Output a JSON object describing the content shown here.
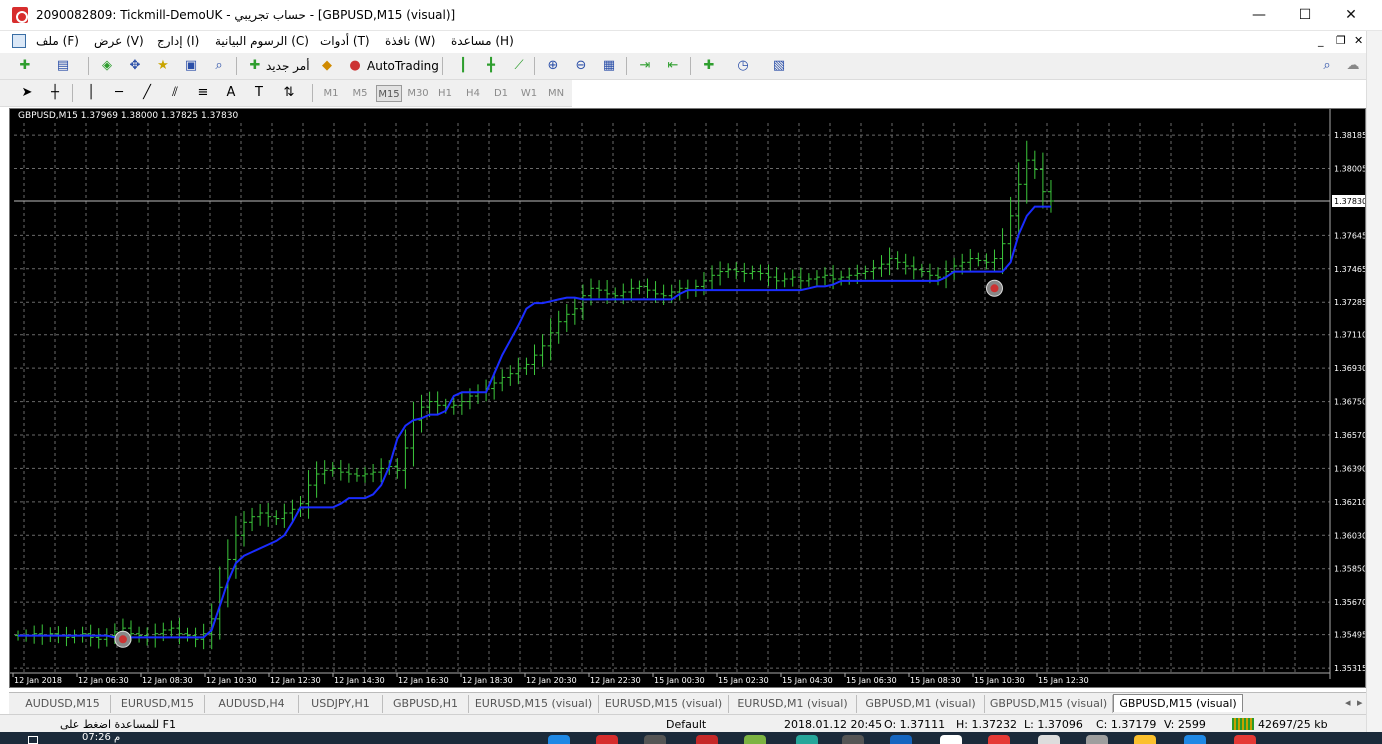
{
  "window": {
    "title": "2090082809: Tickmill-DemoUK - حساب تجريبي - [GBPUSD,M15 (visual)]",
    "min_glyph": "—",
    "max_glyph": "☐",
    "close_glyph": "✕"
  },
  "menu": {
    "items": [
      "ملف (F)",
      "عرض (V)",
      "إدارج (I)",
      "الرسوم البيانية (C)",
      "أدوات (T)",
      "نافذة (W)",
      "مساعدة (H)"
    ],
    "mdi_controls": [
      "_",
      "❐",
      "✕"
    ]
  },
  "toolbar": {
    "new_order_label": "أمر جديد",
    "autotrading_label": "AutoTrading"
  },
  "timeframes": {
    "items": [
      "M1",
      "M5",
      "M15",
      "M30",
      "H1",
      "H4",
      "D1",
      "W1",
      "MN"
    ],
    "active": "M15"
  },
  "chart_header": "GBPUSD,M15  1.37969 1.38000 1.37825 1.37830",
  "chart_data": {
    "type": "candlestick",
    "symbol": "GBPUSD",
    "timeframe": "M15",
    "ohlc_readout": {
      "open": 1.37969,
      "high": 1.38,
      "low": 1.37825,
      "close": 1.3783
    },
    "current_price": "1.37830",
    "ylim": [
      1.3531,
      1.3825
    ],
    "y_tick_labels": [
      "1.38185",
      "1.38005",
      "1.37830",
      "1.37645",
      "1.37465",
      "1.37285",
      "1.37110",
      "1.36930",
      "1.36750",
      "1.36570",
      "1.36390",
      "1.36210",
      "1.36030",
      "1.35850",
      "1.35670",
      "1.35495",
      "1.35315"
    ],
    "y_tick_values": [
      1.38185,
      1.38005,
      1.3783,
      1.37645,
      1.37465,
      1.37285,
      1.3711,
      1.3693,
      1.3675,
      1.3657,
      1.3639,
      1.3621,
      1.3603,
      1.3585,
      1.3567,
      1.35495,
      1.35315
    ],
    "x_tick_labels": [
      "12 Jan 2018",
      "12 Jan 06:30",
      "12 Jan 08:30",
      "12 Jan 10:30",
      "12 Jan 12:30",
      "12 Jan 14:30",
      "12 Jan 16:30",
      "12 Jan 18:30",
      "12 Jan 20:30",
      "12 Jan 22:30",
      "15 Jan 00:30",
      "15 Jan 02:30",
      "15 Jan 04:30",
      "15 Jan 06:30",
      "15 Jan 08:30",
      "15 Jan 10:30",
      "15 Jan 12:30"
    ],
    "price_series": [
      1.3549,
      1.3549,
      1.355,
      1.3549,
      1.355,
      1.3549,
      1.3548,
      1.3549,
      1.355,
      1.3548,
      1.3547,
      1.3549,
      1.3551,
      1.3553,
      1.355,
      1.3549,
      1.3548,
      1.355,
      1.3552,
      1.3553,
      1.355,
      1.3549,
      1.3547,
      1.355,
      1.3558,
      1.3575,
      1.359,
      1.3603,
      1.361,
      1.3613,
      1.3615,
      1.3613,
      1.3612,
      1.3615,
      1.3617,
      1.362,
      1.363,
      1.3636,
      1.3638,
      1.3639,
      1.3637,
      1.3636,
      1.3635,
      1.3636,
      1.3637,
      1.3639,
      1.364,
      1.3638,
      1.365,
      1.3665,
      1.3672,
      1.3675,
      1.3673,
      1.3672,
      1.3673,
      1.3675,
      1.3678,
      1.368,
      1.3682,
      1.3685,
      1.3688,
      1.369,
      1.3693,
      1.3695,
      1.37,
      1.3705,
      1.3712,
      1.3718,
      1.3722,
      1.3725,
      1.3732,
      1.3736,
      1.3735,
      1.3733,
      1.3732,
      1.3734,
      1.3736,
      1.3737,
      1.3735,
      1.3733,
      1.3732,
      1.3734,
      1.3736,
      1.3735,
      1.3737,
      1.374,
      1.3743,
      1.3745,
      1.3746,
      1.3745,
      1.3744,
      1.3745,
      1.3744,
      1.3742,
      1.374,
      1.3741,
      1.3742,
      1.374,
      1.3741,
      1.3742,
      1.3743,
      1.3741,
      1.3742,
      1.3743,
      1.3744,
      1.3745,
      1.3747,
      1.3749,
      1.3752,
      1.375,
      1.3748,
      1.3746,
      1.3745,
      1.3743,
      1.3742,
      1.3745,
      1.3748,
      1.375,
      1.3752,
      1.3751,
      1.375,
      1.3752,
      1.376,
      1.3775,
      1.3792,
      1.3805,
      1.38,
      1.3788,
      1.3783
    ],
    "indicator_series": [
      1.3549,
      1.3549,
      1.3549,
      1.3549,
      1.3549,
      1.3549,
      1.3549,
      1.3549,
      1.3549,
      1.3549,
      1.3549,
      1.3549,
      1.3548,
      1.3548,
      1.3548,
      1.3548,
      1.3548,
      1.3548,
      1.3548,
      1.3548,
      1.3548,
      1.3548,
      1.3548,
      1.3548,
      1.3552,
      1.3565,
      1.3578,
      1.3588,
      1.3592,
      1.3594,
      1.3596,
      1.3598,
      1.36,
      1.3603,
      1.361,
      1.3618,
      1.3618,
      1.3618,
      1.3618,
      1.3618,
      1.362,
      1.3623,
      1.3623,
      1.3623,
      1.3625,
      1.363,
      1.364,
      1.3655,
      1.3662,
      1.3665,
      1.3666,
      1.3668,
      1.3668,
      1.367,
      1.3678,
      1.368,
      1.368,
      1.368,
      1.368,
      1.369,
      1.37,
      1.3708,
      1.3716,
      1.3725,
      1.3728,
      1.3728,
      1.3729,
      1.373,
      1.3731,
      1.3731,
      1.373,
      1.373,
      1.373,
      1.373,
      1.373,
      1.373,
      1.373,
      1.373,
      1.373,
      1.373,
      1.373,
      1.373,
      1.3733,
      1.3735,
      1.3735,
      1.3735,
      1.3735,
      1.3735,
      1.3735,
      1.3735,
      1.3735,
      1.3735,
      1.3735,
      1.3735,
      1.3735,
      1.3735,
      1.3735,
      1.3735,
      1.3736,
      1.3737,
      1.3737,
      1.3738,
      1.374,
      1.374,
      1.374,
      1.374,
      1.374,
      1.374,
      1.374,
      1.374,
      1.374,
      1.374,
      1.374,
      1.374,
      1.374,
      1.3742,
      1.3745,
      1.3745,
      1.3745,
      1.3745,
      1.3745,
      1.3745,
      1.3745,
      1.375,
      1.3765,
      1.3775,
      1.378,
      1.378,
      1.378
    ],
    "markers": [
      {
        "index": 13,
        "price": 1.3547
      },
      {
        "index": 121,
        "price": 1.3736
      }
    ],
    "grid": true,
    "colors": {
      "background": "#000000",
      "candles": "#3cc83c",
      "indicator": "#1a2cff",
      "grid": "#6a6a6a",
      "axis_text": "#ffffff",
      "marker": "#cc3333"
    }
  },
  "tabs": {
    "items": [
      "AUDUSD,M15",
      "EURUSD,M15",
      "AUDUSD,H4",
      "USDJPY,H1",
      "GBPUSD,H1",
      "EURUSD,M15 (visual)",
      "EURUSD,M15 (visual)",
      "EURUSD,M1 (visual)",
      "GBPUSD,M1 (visual)",
      "GBPUSD,M15 (visual)",
      "GBPUSD,M15 (visual)"
    ],
    "active_index": 10
  },
  "status": {
    "help": "للمساعدة اضغط على F1",
    "profile": "Default",
    "datetime": "2018.01.12 20:45",
    "open": "O: 1.37111",
    "high": "H: 1.37232",
    "low": "L: 1.37096",
    "close": "C: 1.37179",
    "volume": "V: 2599",
    "traffic": "42697/25 kb"
  },
  "taskbar": {
    "clock": "07:26 م"
  }
}
